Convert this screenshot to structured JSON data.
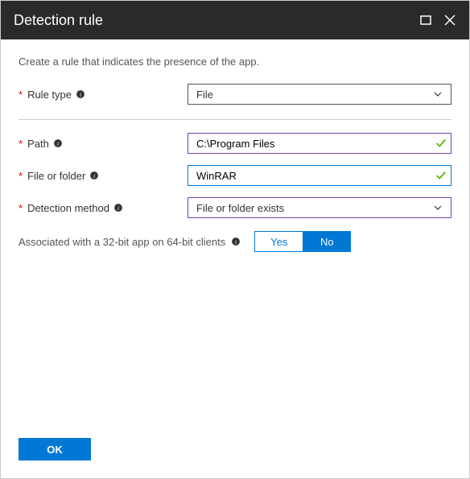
{
  "header": {
    "title": "Detection rule"
  },
  "description": "Create a rule that indicates the presence of the app.",
  "fields": {
    "ruleType": {
      "label": "Rule type",
      "value": "File"
    },
    "path": {
      "label": "Path",
      "value": "C:\\Program Files"
    },
    "fileOrFolder": {
      "label": "File or folder",
      "value": "WinRAR"
    },
    "detectionMethod": {
      "label": "Detection method",
      "value": "File or folder exists"
    },
    "associated32bit": {
      "label": "Associated with a 32-bit app on 64-bit clients",
      "yes": "Yes",
      "no": "No",
      "selected": "No"
    }
  },
  "buttons": {
    "ok": "OK"
  }
}
